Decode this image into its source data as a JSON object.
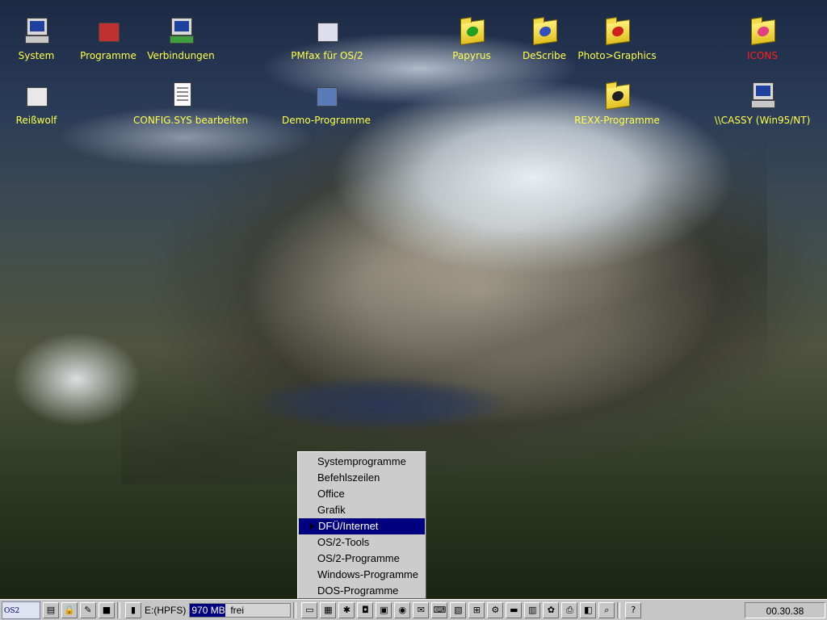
{
  "desktop": {
    "icons": [
      {
        "label": "System",
        "icon": "computer-icon"
      },
      {
        "label": "Programme",
        "icon": "programs-icon"
      },
      {
        "label": "Verbindungen",
        "icon": "connections-icon"
      },
      {
        "label": "PMfax für OS/2",
        "icon": "fax-icon"
      },
      {
        "label": "Papyrus",
        "icon": "folder-icon"
      },
      {
        "label": "DeScribe",
        "icon": "folder-icon"
      },
      {
        "label": "Photo>Graphics",
        "icon": "folder-icon"
      },
      {
        "label": "ICONS",
        "icon": "folder-icon"
      },
      {
        "label": "Reißwolf",
        "icon": "shredder-icon"
      },
      {
        "label": "CONFIG.SYS bearbeiten",
        "icon": "edit-document-icon"
      },
      {
        "label": "Demo-Programme",
        "icon": "demo-icon"
      },
      {
        "label": "REXX-Programme",
        "icon": "folder-icon"
      },
      {
        "label": "\\\\CASSY (Win95/NT)",
        "icon": "network-icon"
      }
    ]
  },
  "popup_menu": {
    "items": [
      {
        "label": "Systemprogramme"
      },
      {
        "label": "Befehlszeilen"
      },
      {
        "label": "Office"
      },
      {
        "label": "Grafik"
      },
      {
        "label": "DFÜ/Internet",
        "selected": true
      },
      {
        "label": "OS/2-Tools"
      },
      {
        "label": "OS/2-Programme"
      },
      {
        "label": "Windows-Programme"
      },
      {
        "label": "DOS-Programme"
      }
    ]
  },
  "taskbar": {
    "logo_text": "OS2",
    "drive": "E:(HPFS)",
    "free_value": "970 MB",
    "free_label": "frei",
    "free_fraction": 0.35,
    "clock": "00.30.38"
  },
  "colors": {
    "icon_text": "#ffff4a",
    "icon_text_alert": "#ff2020",
    "menu_highlight": "#00007f",
    "taskbar": "#c6c6c6"
  }
}
